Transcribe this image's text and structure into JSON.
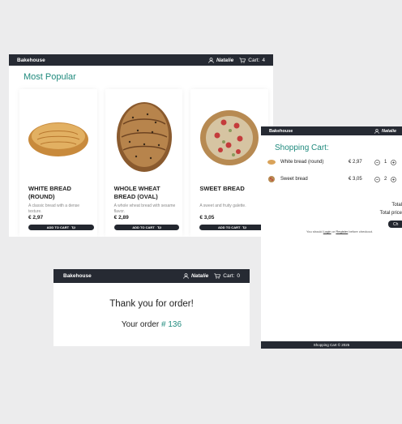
{
  "home": {
    "brand": "Bakehouse",
    "user": "Natalie",
    "cart_label": "Cart:",
    "cart_count": "4",
    "section_title": "Most Popular",
    "products": [
      {
        "name": "WHITE BREAD (ROUND)",
        "desc": "A classic bread with a dense texture.",
        "price": "€ 2,97",
        "button": "ADD TO CART"
      },
      {
        "name": "WHOLE WHEAT BREAD (OVAL)",
        "desc": "A whole wheat bread with sesame flavor.",
        "price": "€ 2,89",
        "button": "ADD TO CART"
      },
      {
        "name": "SWEET BREAD",
        "desc": "A sweet and fruity galette.",
        "price": "€ 3,05",
        "button": "ADD TO CART"
      }
    ]
  },
  "cart_page": {
    "brand": "Bakehouse",
    "user": "Natalie",
    "title": "Shopping Cart:",
    "items": [
      {
        "name": "White bread (round)",
        "price": "€ 2,97",
        "qty": "1"
      },
      {
        "name": "Sweet bread",
        "price": "€ 3,05",
        "qty": "2"
      }
    ],
    "total_label": "Total",
    "total_price_label": "Total price",
    "checkout_label": "Ch",
    "note_prefix": "You should",
    "note_login": "Login",
    "note_or": "or",
    "note_register": "Register",
    "note_suffix": "before checkout.",
    "footer": "Shopping Cart © 2025"
  },
  "confirm_page": {
    "brand": "Bakehouse",
    "user": "Natalie",
    "cart_label": "Cart:",
    "cart_count": "0",
    "thanks": "Thank you for order!",
    "order_prefix": "Your order",
    "order_number": "# 136"
  },
  "colors": {
    "navbar": "#262a33",
    "accent": "#1f8a7d",
    "background": "#ececed"
  }
}
